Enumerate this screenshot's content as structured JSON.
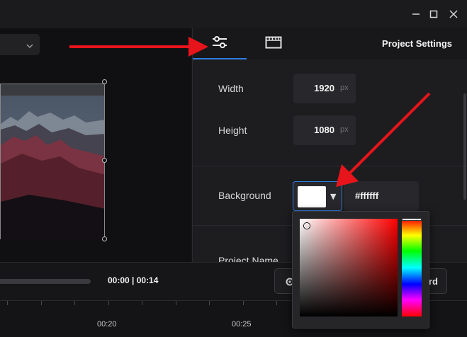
{
  "panel": {
    "title": "Project Settings",
    "tabs": [
      {
        "icon": "sliders-icon",
        "active": true
      },
      {
        "icon": "film-icon",
        "active": false
      }
    ],
    "width": {
      "label": "Width",
      "value": "1920",
      "unit": "px"
    },
    "height": {
      "label": "Height",
      "value": "1080",
      "unit": "px"
    },
    "background": {
      "label": "Background",
      "hex": "#ffffff",
      "swatch_color": "#ffffff"
    },
    "project_name_label": "Project Name"
  },
  "player": {
    "time": "00:00 | 00:14",
    "render_button_label": "rd"
  },
  "timeline": {
    "ticks": [
      "00:20",
      "00:25"
    ]
  },
  "colors": {
    "accent": "#2f7de1",
    "annotation_arrow": "#e8141b"
  }
}
